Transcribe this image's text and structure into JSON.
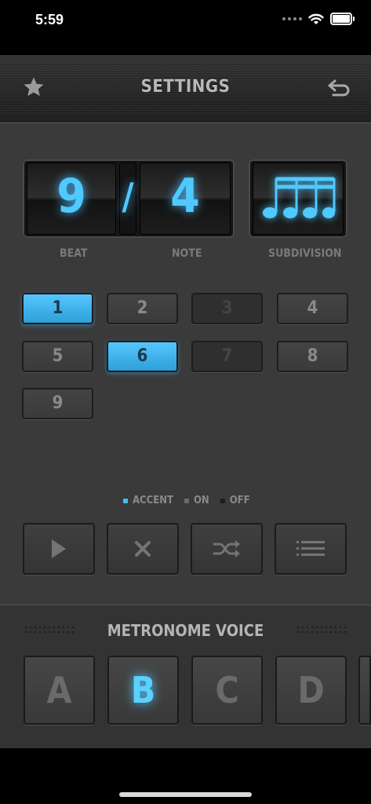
{
  "status": {
    "time": "5:59"
  },
  "header": {
    "title": "SETTINGS"
  },
  "time_signature": {
    "beat": "9",
    "separator": "/",
    "note": "4"
  },
  "labels": {
    "beat": "BEAT",
    "note": "NOTE",
    "subdivision": "SUBDIVISION"
  },
  "beats": [
    {
      "label": "1",
      "state": "accent"
    },
    {
      "label": "2",
      "state": "on"
    },
    {
      "label": "3",
      "state": "off"
    },
    {
      "label": "4",
      "state": "on"
    },
    {
      "label": "5",
      "state": "on"
    },
    {
      "label": "6",
      "state": "accent"
    },
    {
      "label": "7",
      "state": "off"
    },
    {
      "label": "8",
      "state": "on"
    },
    {
      "label": "9",
      "state": "on"
    }
  ],
  "legend": {
    "accent": "ACCENT",
    "on": "ON",
    "off": "OFF"
  },
  "actions": [
    "play-icon",
    "clear-icon",
    "shuffle-icon",
    "list-icon"
  ],
  "voice": {
    "title": "METRONOME VOICE",
    "options": [
      "A",
      "B",
      "C",
      "D"
    ],
    "selected": "B"
  },
  "colors": {
    "accent": "#45bff5",
    "glow": "#4fc9ff"
  }
}
